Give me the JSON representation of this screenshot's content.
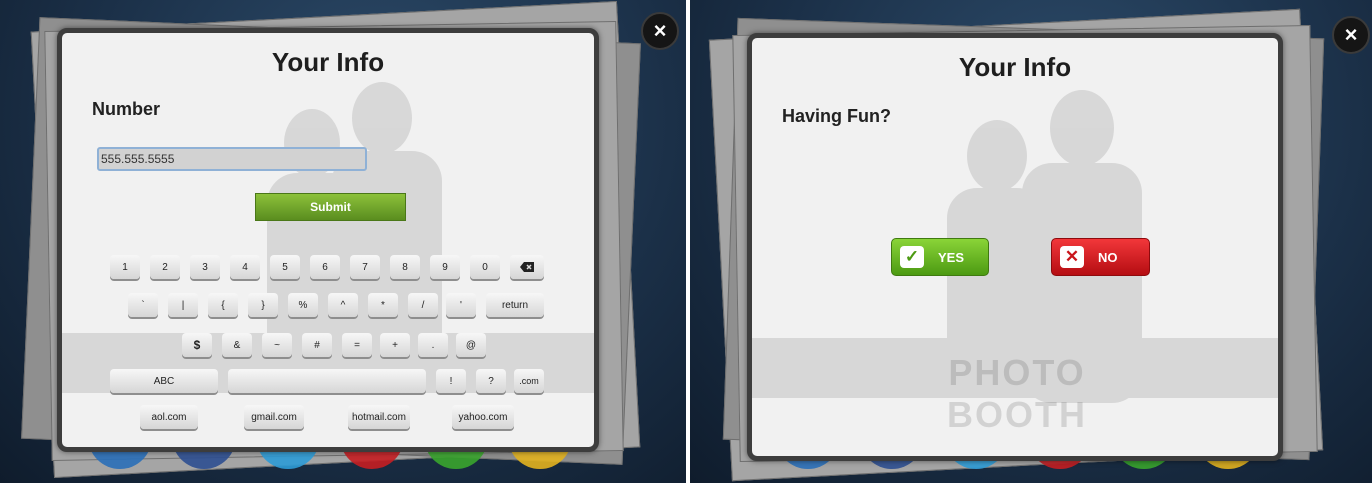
{
  "colors": {
    "submit": "#6ea42a",
    "yes": "#5fae1b",
    "no": "#d41d22",
    "input_border": "#8fb1d6"
  },
  "left": {
    "close_icon": "close-icon",
    "title": "Your Info",
    "field_label": "Number",
    "phone_value": "555.555.5555",
    "submit_label": "Submit",
    "keyboard": {
      "row1": [
        "1",
        "2",
        "3",
        "4",
        "5",
        "6",
        "7",
        "8",
        "9",
        "0"
      ],
      "backspace_icon": "backspace-icon",
      "row2": [
        "`",
        "|",
        "{",
        "}",
        "%",
        "^",
        "*",
        "/",
        "'"
      ],
      "return_label": "return",
      "row3": [
        "$",
        "&",
        "~",
        "#",
        "=",
        "+",
        ".",
        "@"
      ],
      "abc_label": "ABC",
      "exclaim": "!",
      "question": "?",
      "dotcom": ".com",
      "domains": [
        "aol.com",
        "gmail.com",
        "hotmail.com",
        "yahoo.com"
      ]
    }
  },
  "right": {
    "close_icon": "close-icon",
    "title": "Your Info",
    "question": "Having Fun?",
    "yes_label": "YES",
    "no_label": "NO",
    "watermark": "PHOTO BOOTH"
  }
}
